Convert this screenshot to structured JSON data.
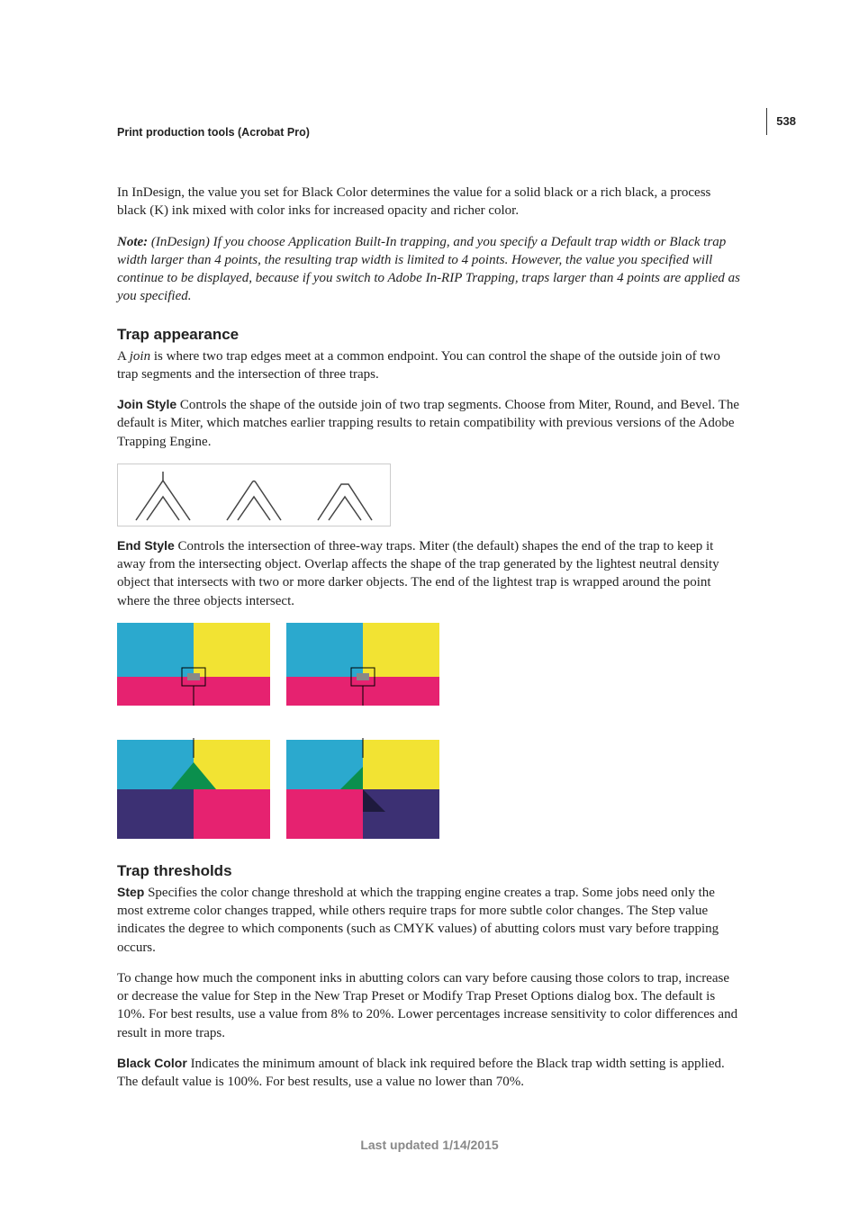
{
  "page_number": "538",
  "running_head": "Print production tools (Acrobat Pro)",
  "intro_para": "In InDesign, the value you set for Black Color determines the value for a solid black or a rich black, a process black (K) ink mixed with color inks for increased opacity and richer color.",
  "note_label": "Note:",
  "note_body": " (InDesign) If you choose Application Built-In trapping, and you specify a Default trap width or Black trap width larger than 4 points, the resulting trap width is limited to 4 points. However, the value you specified will continue to be displayed, because if you switch to Adobe In-RIP Trapping, traps larger than 4 points are applied as you specified.",
  "section1_title": "Trap appearance",
  "section1_intro_pre": "A ",
  "section1_intro_em": "join",
  "section1_intro_post": " is where two trap edges meet at a common endpoint. You can control the shape of the outside join of two trap segments and the intersection of three traps.",
  "join_style_label": "Join Style",
  "join_style_body": "  Controls the shape of the outside join of two trap segments. Choose from Miter, Round, and Bevel. The default is Miter, which matches earlier trapping results to retain compatibility with previous versions of the Adobe Trapping Engine.",
  "end_style_label": "End Style",
  "end_style_body": "  Controls the intersection of three-way traps. Miter (the default) shapes the end of the trap to keep it away from the intersecting object. Overlap affects the shape of the trap generated by the lightest neutral density object that intersects with two or more darker objects. The end of the lightest trap is wrapped around the point where the three objects intersect.",
  "section2_title": "Trap thresholds",
  "step_label": "Step",
  "step_body": "  Specifies the color change threshold at which the trapping engine creates a trap. Some jobs need only the most extreme color changes trapped, while others require traps for more subtle color changes. The Step value indicates the degree to which components (such as CMYK values) of abutting colors must vary before trapping occurs.",
  "step_para2": "To change how much the component inks in abutting colors can vary before causing those colors to trap, increase or decrease the value for Step in the New Trap Preset or Modify Trap Preset Options dialog box. The default is 10%. For best results, use a value from 8% to 20%. Lower percentages increase sensitivity to color differences and result in more traps.",
  "black_color_label": "Black Color",
  "black_color_body": "  Indicates the minimum amount of black ink required before the Black trap width setting is applied. The default value is 100%. For best results, use a value no lower than 70%.",
  "footer": "Last updated 1/14/2015",
  "colors": {
    "cyan": "#2BA9CE",
    "yellow": "#F2E333",
    "magenta": "#E62270",
    "indigo": "#3C3073",
    "green": "#0B8F4D",
    "white": "#FFFFFF"
  }
}
